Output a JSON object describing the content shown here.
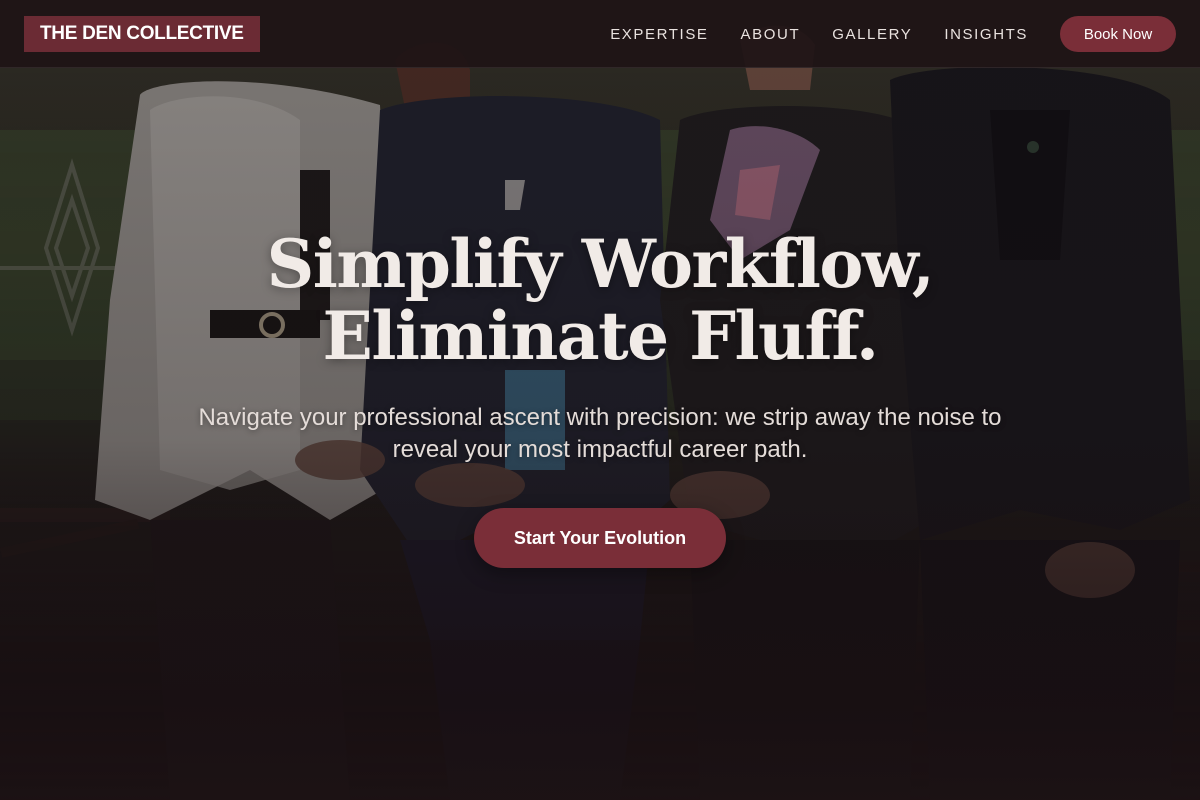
{
  "header": {
    "logo_text": "THE DEN COLLECTIVE",
    "nav_items": [
      {
        "label": "EXPERTISE"
      },
      {
        "label": "ABOUT"
      },
      {
        "label": "GALLERY"
      },
      {
        "label": "INSIGHTS"
      }
    ],
    "book_button_label": "Book Now"
  },
  "hero": {
    "title_line_1": "Simplify Workflow,",
    "title_line_2": "Eliminate Fluff.",
    "subtitle": "Navigate your professional ascent with precision: we strip away the noise to reveal your most impactful career path.",
    "cta_label": "Start Your Evolution"
  },
  "colors": {
    "brand": "#6b2b34",
    "button": "#7a2e38",
    "header_bg": "#1e1416",
    "text_light": "#f1ebe7"
  }
}
